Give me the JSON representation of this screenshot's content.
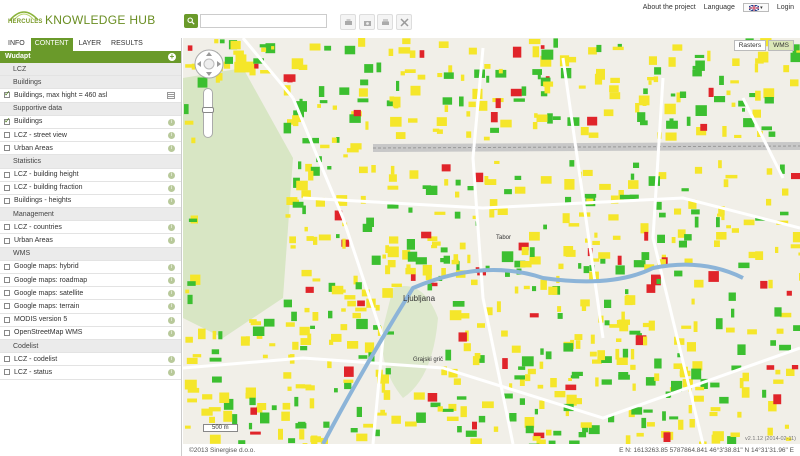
{
  "app": {
    "logo_text": "HERCULES",
    "title": "KNOWLEDGE HUB"
  },
  "header": {
    "search_placeholder": "",
    "about": "About the project",
    "language": "Language",
    "login": "Login",
    "tool_icons": [
      "print-icon",
      "camera-icon",
      "printer-icon",
      "tools-icon"
    ]
  },
  "tabs": [
    {
      "label": "INFO",
      "active": false
    },
    {
      "label": "CONTENT",
      "active": true
    },
    {
      "label": "LAYER",
      "active": false
    },
    {
      "label": "RESULTS",
      "active": false
    }
  ],
  "panel": {
    "title": "Wudapt",
    "rows": [
      {
        "type": "header",
        "label": "LCZ"
      },
      {
        "type": "header",
        "label": "Buildings"
      },
      {
        "type": "item",
        "label": "Buildings, max hight = 460 asl",
        "checked": true,
        "icon": "legend"
      },
      {
        "type": "header",
        "label": "Supportive data"
      },
      {
        "type": "item",
        "label": "Buildings",
        "checked": true,
        "icon": "info"
      },
      {
        "type": "item",
        "label": "LCZ - street view",
        "checked": false,
        "icon": "info"
      },
      {
        "type": "item",
        "label": "Urban Areas",
        "checked": false,
        "icon": "info"
      },
      {
        "type": "header",
        "label": "Statistics"
      },
      {
        "type": "item",
        "label": "LCZ - building height",
        "checked": false,
        "icon": "info"
      },
      {
        "type": "item",
        "label": "LCZ - building fraction",
        "checked": false,
        "icon": "info"
      },
      {
        "type": "item",
        "label": "Buildings - heights",
        "checked": false,
        "icon": "info"
      },
      {
        "type": "header",
        "label": "Management"
      },
      {
        "type": "item",
        "label": "LCZ - countries",
        "checked": false,
        "icon": "info"
      },
      {
        "type": "item",
        "label": "Urban Areas",
        "checked": false,
        "icon": "info"
      },
      {
        "type": "header",
        "label": "WMS"
      },
      {
        "type": "item",
        "label": "Google maps: hybrid",
        "checked": false,
        "icon": "info"
      },
      {
        "type": "item",
        "label": "Google maps: roadmap",
        "checked": false,
        "icon": "info"
      },
      {
        "type": "item",
        "label": "Google maps: satellite",
        "checked": false,
        "icon": "info"
      },
      {
        "type": "item",
        "label": "Google maps: terrain",
        "checked": false,
        "icon": "info"
      },
      {
        "type": "item",
        "label": "MODIS version 5",
        "checked": false,
        "icon": "info"
      },
      {
        "type": "item",
        "label": "OpenStreetMap WMS",
        "checked": false,
        "icon": "info"
      },
      {
        "type": "header",
        "label": "Codelist"
      },
      {
        "type": "item",
        "label": "LCZ - codelist",
        "checked": false,
        "icon": "info"
      },
      {
        "type": "item",
        "label": "LCZ - status",
        "checked": false,
        "icon": "info"
      }
    ]
  },
  "map": {
    "buttons": [
      {
        "label": "Rasters",
        "active": false
      },
      {
        "label": "WMS",
        "active": true
      }
    ],
    "scale_label": "500 m",
    "version": "v2.1.12 (2014-02-11)",
    "place_labels": [
      "Ljubljana",
      "Tabor",
      "Grajski grič"
    ]
  },
  "status": {
    "copyright": "©2013 Sinergise d.o.o.",
    "coords": "E N: 1613263.85 5787864.841     46°3'38.81\" N 14°31'31.96\" E"
  },
  "colors": {
    "accent": "#6a9a2a",
    "building_low": "#f5e62a",
    "building_mid": "#3cbf30",
    "building_high": "#e0242a"
  }
}
